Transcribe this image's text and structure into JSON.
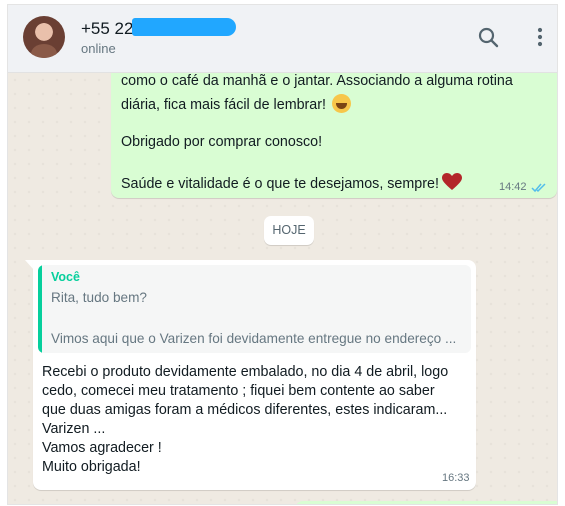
{
  "header": {
    "contact_name": "+55 22",
    "status": "online",
    "icons": {
      "avatar": "avatar",
      "search": "search-icon",
      "menu": "menu-icon"
    },
    "redaction_color": "#21a7ff"
  },
  "messages": {
    "outgoing": {
      "lines": [
        "como o café da manhã e o jantar. Associando a alguma rotina",
        "diária, fica mais fácil de lembrar!",
        "Obrigado por comprar conosco!",
        "Saúde e vitalidade é o que te desejamos, sempre!"
      ],
      "time": "14:42",
      "status_icon": "double-check-icon",
      "emojis": [
        "laughing-face-emoji",
        "red-heart-emoji"
      ]
    },
    "date_divider": "HOJE",
    "incoming": {
      "quoted": {
        "author": "Você",
        "lines": [
          "Rita, tudo bem?",
          "Vimos aqui que o Varizen foi devidamente entregue no endereço ..."
        ]
      },
      "lines": [
        "Recebi o produto devidamente embalado, no dia 4 de abril, logo",
        "cedo, comecei meu tratamento ; fiquei bem contente ao saber",
        "que duas amigas foram a médicos diferentes, estes indicaram...",
        "Varizen ...",
        "Vamos agradecer !",
        "Muito obrigada!"
      ],
      "time": "16:33"
    }
  },
  "colors": {
    "header_bg": "#f0f2f5",
    "chat_bg": "#efeae2",
    "outgoing_bubble": "#d9fdd3",
    "incoming_bubble": "#ffffff",
    "quote_accent": "#06cf9c",
    "read_ticks": "#53bdeb"
  }
}
